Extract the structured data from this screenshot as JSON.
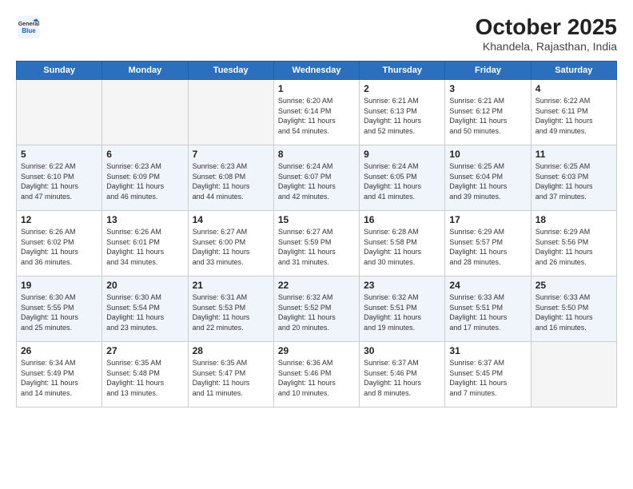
{
  "header": {
    "logo_general": "General",
    "logo_blue": "Blue",
    "title": "October 2025",
    "subtitle": "Khandela, Rajasthan, India"
  },
  "weekdays": [
    "Sunday",
    "Monday",
    "Tuesday",
    "Wednesday",
    "Thursday",
    "Friday",
    "Saturday"
  ],
  "weeks": [
    {
      "shaded": false,
      "days": [
        {
          "num": "",
          "detail": ""
        },
        {
          "num": "",
          "detail": ""
        },
        {
          "num": "",
          "detail": ""
        },
        {
          "num": "1",
          "detail": "Sunrise: 6:20 AM\nSunset: 6:14 PM\nDaylight: 11 hours\nand 54 minutes."
        },
        {
          "num": "2",
          "detail": "Sunrise: 6:21 AM\nSunset: 6:13 PM\nDaylight: 11 hours\nand 52 minutes."
        },
        {
          "num": "3",
          "detail": "Sunrise: 6:21 AM\nSunset: 6:12 PM\nDaylight: 11 hours\nand 50 minutes."
        },
        {
          "num": "4",
          "detail": "Sunrise: 6:22 AM\nSunset: 6:11 PM\nDaylight: 11 hours\nand 49 minutes."
        }
      ]
    },
    {
      "shaded": true,
      "days": [
        {
          "num": "5",
          "detail": "Sunrise: 6:22 AM\nSunset: 6:10 PM\nDaylight: 11 hours\nand 47 minutes."
        },
        {
          "num": "6",
          "detail": "Sunrise: 6:23 AM\nSunset: 6:09 PM\nDaylight: 11 hours\nand 46 minutes."
        },
        {
          "num": "7",
          "detail": "Sunrise: 6:23 AM\nSunset: 6:08 PM\nDaylight: 11 hours\nand 44 minutes."
        },
        {
          "num": "8",
          "detail": "Sunrise: 6:24 AM\nSunset: 6:07 PM\nDaylight: 11 hours\nand 42 minutes."
        },
        {
          "num": "9",
          "detail": "Sunrise: 6:24 AM\nSunset: 6:05 PM\nDaylight: 11 hours\nand 41 minutes."
        },
        {
          "num": "10",
          "detail": "Sunrise: 6:25 AM\nSunset: 6:04 PM\nDaylight: 11 hours\nand 39 minutes."
        },
        {
          "num": "11",
          "detail": "Sunrise: 6:25 AM\nSunset: 6:03 PM\nDaylight: 11 hours\nand 37 minutes."
        }
      ]
    },
    {
      "shaded": false,
      "days": [
        {
          "num": "12",
          "detail": "Sunrise: 6:26 AM\nSunset: 6:02 PM\nDaylight: 11 hours\nand 36 minutes."
        },
        {
          "num": "13",
          "detail": "Sunrise: 6:26 AM\nSunset: 6:01 PM\nDaylight: 11 hours\nand 34 minutes."
        },
        {
          "num": "14",
          "detail": "Sunrise: 6:27 AM\nSunset: 6:00 PM\nDaylight: 11 hours\nand 33 minutes."
        },
        {
          "num": "15",
          "detail": "Sunrise: 6:27 AM\nSunset: 5:59 PM\nDaylight: 11 hours\nand 31 minutes."
        },
        {
          "num": "16",
          "detail": "Sunrise: 6:28 AM\nSunset: 5:58 PM\nDaylight: 11 hours\nand 30 minutes."
        },
        {
          "num": "17",
          "detail": "Sunrise: 6:29 AM\nSunset: 5:57 PM\nDaylight: 11 hours\nand 28 minutes."
        },
        {
          "num": "18",
          "detail": "Sunrise: 6:29 AM\nSunset: 5:56 PM\nDaylight: 11 hours\nand 26 minutes."
        }
      ]
    },
    {
      "shaded": true,
      "days": [
        {
          "num": "19",
          "detail": "Sunrise: 6:30 AM\nSunset: 5:55 PM\nDaylight: 11 hours\nand 25 minutes."
        },
        {
          "num": "20",
          "detail": "Sunrise: 6:30 AM\nSunset: 5:54 PM\nDaylight: 11 hours\nand 23 minutes."
        },
        {
          "num": "21",
          "detail": "Sunrise: 6:31 AM\nSunset: 5:53 PM\nDaylight: 11 hours\nand 22 minutes."
        },
        {
          "num": "22",
          "detail": "Sunrise: 6:32 AM\nSunset: 5:52 PM\nDaylight: 11 hours\nand 20 minutes."
        },
        {
          "num": "23",
          "detail": "Sunrise: 6:32 AM\nSunset: 5:51 PM\nDaylight: 11 hours\nand 19 minutes."
        },
        {
          "num": "24",
          "detail": "Sunrise: 6:33 AM\nSunset: 5:51 PM\nDaylight: 11 hours\nand 17 minutes."
        },
        {
          "num": "25",
          "detail": "Sunrise: 6:33 AM\nSunset: 5:50 PM\nDaylight: 11 hours\nand 16 minutes."
        }
      ]
    },
    {
      "shaded": false,
      "days": [
        {
          "num": "26",
          "detail": "Sunrise: 6:34 AM\nSunset: 5:49 PM\nDaylight: 11 hours\nand 14 minutes."
        },
        {
          "num": "27",
          "detail": "Sunrise: 6:35 AM\nSunset: 5:48 PM\nDaylight: 11 hours\nand 13 minutes."
        },
        {
          "num": "28",
          "detail": "Sunrise: 6:35 AM\nSunset: 5:47 PM\nDaylight: 11 hours\nand 11 minutes."
        },
        {
          "num": "29",
          "detail": "Sunrise: 6:36 AM\nSunset: 5:46 PM\nDaylight: 11 hours\nand 10 minutes."
        },
        {
          "num": "30",
          "detail": "Sunrise: 6:37 AM\nSunset: 5:46 PM\nDaylight: 11 hours\nand 8 minutes."
        },
        {
          "num": "31",
          "detail": "Sunrise: 6:37 AM\nSunset: 5:45 PM\nDaylight: 11 hours\nand 7 minutes."
        },
        {
          "num": "",
          "detail": ""
        }
      ]
    }
  ]
}
